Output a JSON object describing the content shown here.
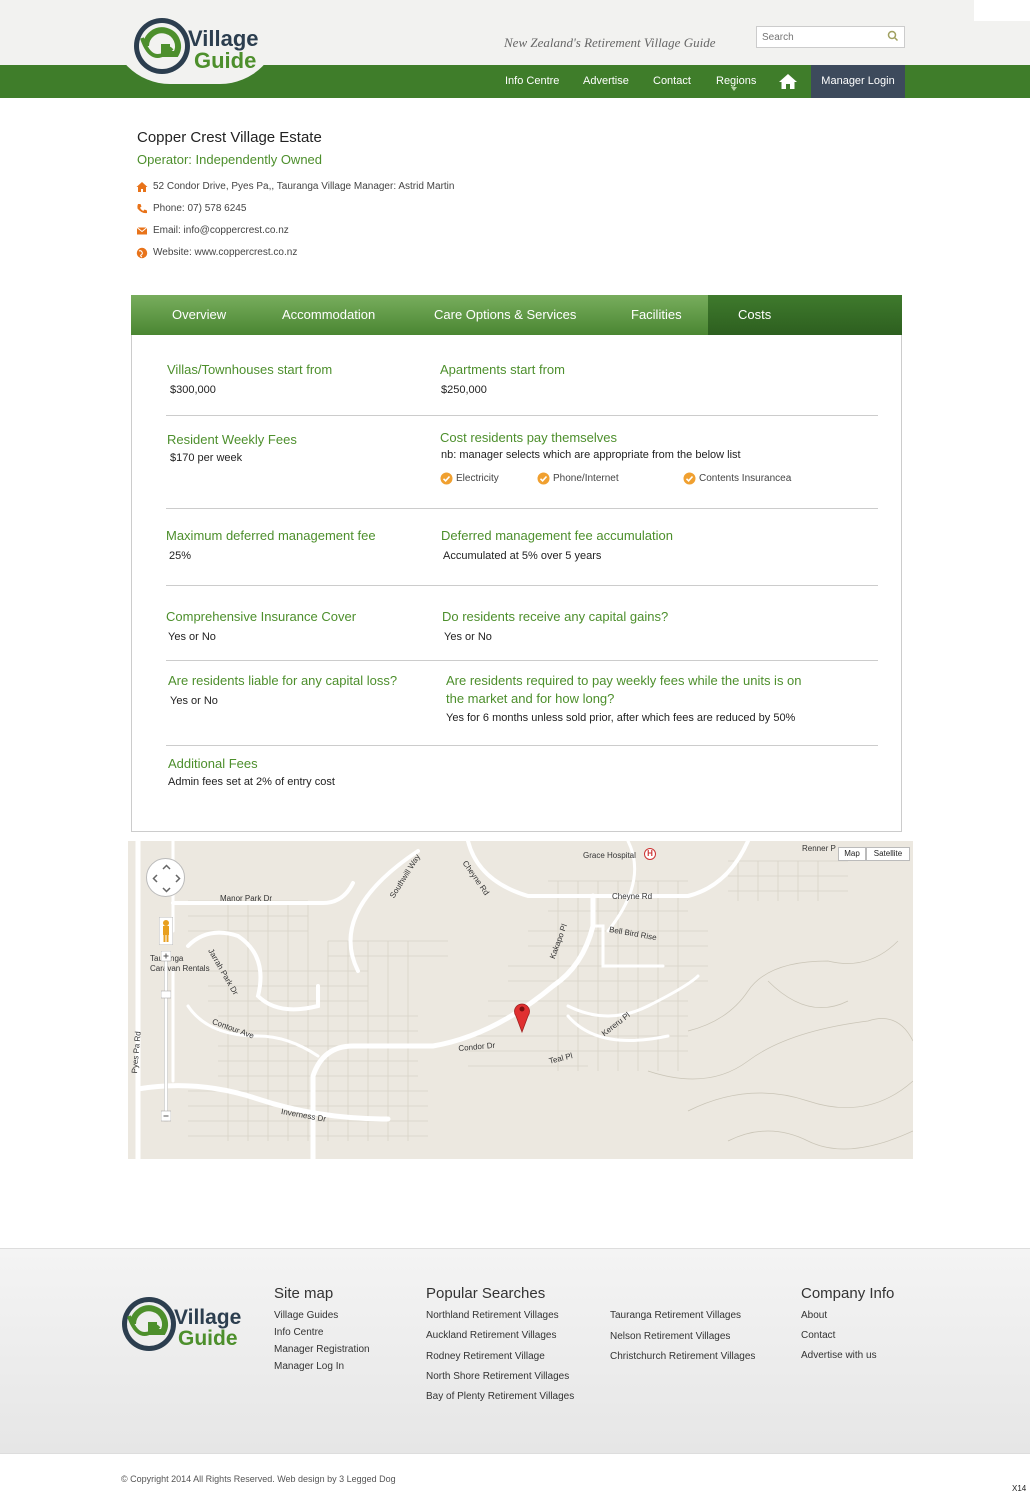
{
  "header": {
    "logo_text_1": "Village",
    "logo_text_2": "Guide",
    "tagline": "New Zealand's Retirement Village Guide",
    "search_placeholder": "Search",
    "nav": [
      "Info Centre",
      "Advertise",
      "Contact",
      "Regions"
    ],
    "manager_login": "Manager Login"
  },
  "village": {
    "title": "Copper Crest Village Estate",
    "operator": "Operator: Independently Owned",
    "address": "52 Condor Drive, Pyes Pa,, Tauranga  Village Manager: Astrid Martin",
    "phone": "Phone: 07) 578 6245",
    "email": "Email: info@coppercrest.co.nz",
    "website": "Website: www.coppercrest.co.nz"
  },
  "tabs": [
    "Overview",
    "Accommodation",
    "Care Options & Services",
    "Facilities",
    "Costs"
  ],
  "costs": {
    "villas_label": "Villas/Townhouses start from",
    "villas_value": "$300,000",
    "apartments_label": "Apartments start from",
    "apartments_value": "$250,000",
    "weekly_label": "Resident Weekly Fees",
    "weekly_value": "$170 per week",
    "self_pay_label": "Cost residents pay themselves",
    "self_pay_note": "nb: manager selects which are appropriate from the below list",
    "self_pay_items": [
      "Electricity",
      "Phone/Internet",
      "Contents Insurancea"
    ],
    "dmf_label": "Maximum deferred management fee",
    "dmf_value": "25%",
    "dmf_acc_label": "Deferred management fee accumulation",
    "dmf_acc_value": "Accumulated at 5% over 5 years",
    "insurance_label": "Comprehensive Insurance Cover",
    "insurance_value": "Yes or No",
    "gains_label": "Do residents receive any capital gains?",
    "gains_value": "Yes or No",
    "loss_label": "Are residents liable for any capital loss?",
    "loss_value": "Yes or No",
    "weekly_market_label_1": "Are residents required to pay weekly fees while the units is on",
    "weekly_market_label_2": "the market and for how long?",
    "weekly_market_value": "Yes for 6 months unless sold prior, after which fees are reduced by 50%",
    "additional_label": "Additional Fees",
    "additional_value": "Admin fees set at 2% of entry cost"
  },
  "map": {
    "map_button": "Map",
    "satellite_button": "Satellite",
    "labels": {
      "renner": "Renner P",
      "grace": "Grace Hospital",
      "cheyne_rd": "Cheyne Rd",
      "cheyne_rd_2": "Cheyne Rd",
      "southwill": "Southwill Way",
      "manor": "Manor Park Dr",
      "bellbird": "Bell Bird Rise",
      "kakapo": "Kakapo Pl",
      "tauranga_1": "Tauranga",
      "tauranga_2": "Caravan Rentals",
      "jarrah": "Jarrah Park Dr",
      "contour": "Contour Ave",
      "condor": "Condor Dr",
      "kereru": "Kereru Pl",
      "teal": "Teal Pl",
      "pyes": "Pyes Pa Rd",
      "inverness": "Inverness Dr",
      "hospital_h": "H"
    }
  },
  "footer": {
    "sitemap_title": "Site map",
    "sitemap": [
      "Village Guides",
      "Info Centre",
      "Manager Registration",
      "Manager Log In"
    ],
    "popular_title": "Popular Searches",
    "popular_col1": [
      "Northland Retirement Villages",
      "Auckland Retirement Villages",
      "Rodney Retirement Village",
      "North Shore Retirement Villages",
      "Bay of Plenty Retirement Villages"
    ],
    "popular_col2": [
      "Tauranga Retirement Villages",
      "Nelson Retirement Villages",
      "Christchurch Retirement Villages"
    ],
    "company_title": "Company Info",
    "company": [
      "About",
      "Contact",
      "Advertise with us"
    ],
    "copyright": "© Copyright 2014 All Rights Reserved. Web design by 3 Legged Dog",
    "corner_tag": "X14"
  },
  "colors": {
    "brand_green": "#3f7d2a",
    "label_green": "#4d8f2c",
    "manager_login_bg": "#3d4a5c",
    "accent_orange": "#e8731a"
  }
}
